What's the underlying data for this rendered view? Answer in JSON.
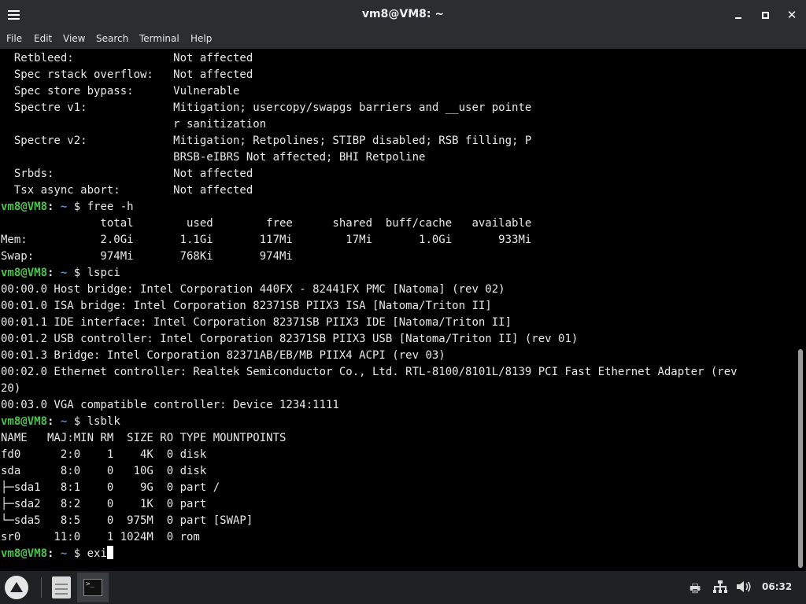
{
  "window": {
    "title": "vm8@VM8: ~"
  },
  "menubar": {
    "items": [
      {
        "label": "File"
      },
      {
        "label": "Edit"
      },
      {
        "label": "View"
      },
      {
        "label": "Search"
      },
      {
        "label": "Terminal"
      },
      {
        "label": "Help"
      }
    ]
  },
  "terminal": {
    "prompt": {
      "user": "vm8@VM8",
      "sep": ":",
      "path": " ~",
      "symbol": " $ "
    },
    "lines": [
      {
        "type": "text",
        "text": "  Retbleed:               Not affected"
      },
      {
        "type": "text",
        "text": "  Spec rstack overflow:   Not affected"
      },
      {
        "type": "text",
        "text": "  Spec store bypass:      Vulnerable"
      },
      {
        "type": "text",
        "text": "  Spectre v1:             Mitigation; usercopy/swapgs barriers and __user pointe"
      },
      {
        "type": "text",
        "text": "                          r sanitization"
      },
      {
        "type": "text",
        "text": "  Spectre v2:             Mitigation; Retpolines; STIBP disabled; RSB filling; P"
      },
      {
        "type": "text",
        "text": "                          BRSB-eIBRS Not affected; BHI Retpoline"
      },
      {
        "type": "text",
        "text": "  Srbds:                  Not affected"
      },
      {
        "type": "text",
        "text": "  Tsx async abort:        Not affected"
      },
      {
        "type": "prompt",
        "command": "free -h"
      },
      {
        "type": "text",
        "text": "               total        used        free      shared  buff/cache   available"
      },
      {
        "type": "text",
        "text": "Mem:           2.0Gi       1.1Gi       117Mi        17Mi       1.0Gi       933Mi"
      },
      {
        "type": "text",
        "text": "Swap:          974Mi       768Ki       974Mi"
      },
      {
        "type": "prompt",
        "command": "lspci"
      },
      {
        "type": "text",
        "text": "00:00.0 Host bridge: Intel Corporation 440FX - 82441FX PMC [Natoma] (rev 02)"
      },
      {
        "type": "text",
        "text": "00:01.0 ISA bridge: Intel Corporation 82371SB PIIX3 ISA [Natoma/Triton II]"
      },
      {
        "type": "text",
        "text": "00:01.1 IDE interface: Intel Corporation 82371SB PIIX3 IDE [Natoma/Triton II]"
      },
      {
        "type": "text",
        "text": "00:01.2 USB controller: Intel Corporation 82371SB PIIX3 USB [Natoma/Triton II] (rev 01)"
      },
      {
        "type": "text",
        "text": "00:01.3 Bridge: Intel Corporation 82371AB/EB/MB PIIX4 ACPI (rev 03)"
      },
      {
        "type": "text",
        "text": "00:02.0 Ethernet controller: Realtek Semiconductor Co., Ltd. RTL-8100/8101L/8139 PCI Fast Ethernet Adapter (rev"
      },
      {
        "type": "text",
        "text": "20)"
      },
      {
        "type": "text",
        "text": "00:03.0 VGA compatible controller: Device 1234:1111"
      },
      {
        "type": "prompt",
        "command": "lsblk"
      },
      {
        "type": "text",
        "text": "NAME   MAJ:MIN RM  SIZE RO TYPE MOUNTPOINTS"
      },
      {
        "type": "text",
        "text": "fd0      2:0    1    4K  0 disk"
      },
      {
        "type": "text",
        "text": "sda      8:0    0   10G  0 disk"
      },
      {
        "type": "text",
        "text": "├─sda1   8:1    0    9G  0 part /"
      },
      {
        "type": "text",
        "text": "├─sda2   8:2    0    1K  0 part"
      },
      {
        "type": "text",
        "text": "└─sda5   8:5    0  975M  0 part [SWAP]"
      },
      {
        "type": "text",
        "text": "sr0     11:0    1 1024M  0 rom"
      },
      {
        "type": "prompt",
        "command": "exi",
        "cursor": true
      }
    ]
  },
  "taskbar": {
    "launcher_icon": "launcher-icon",
    "tray_icons": [
      "printer-icon",
      "network-icon",
      "volume-icon"
    ],
    "clock": "06:32"
  },
  "colors": {
    "prompt_user": "#4ec24e",
    "prompt_path": "#5b8fd6",
    "background": "#000000",
    "titlebar": "#2b2e31"
  }
}
